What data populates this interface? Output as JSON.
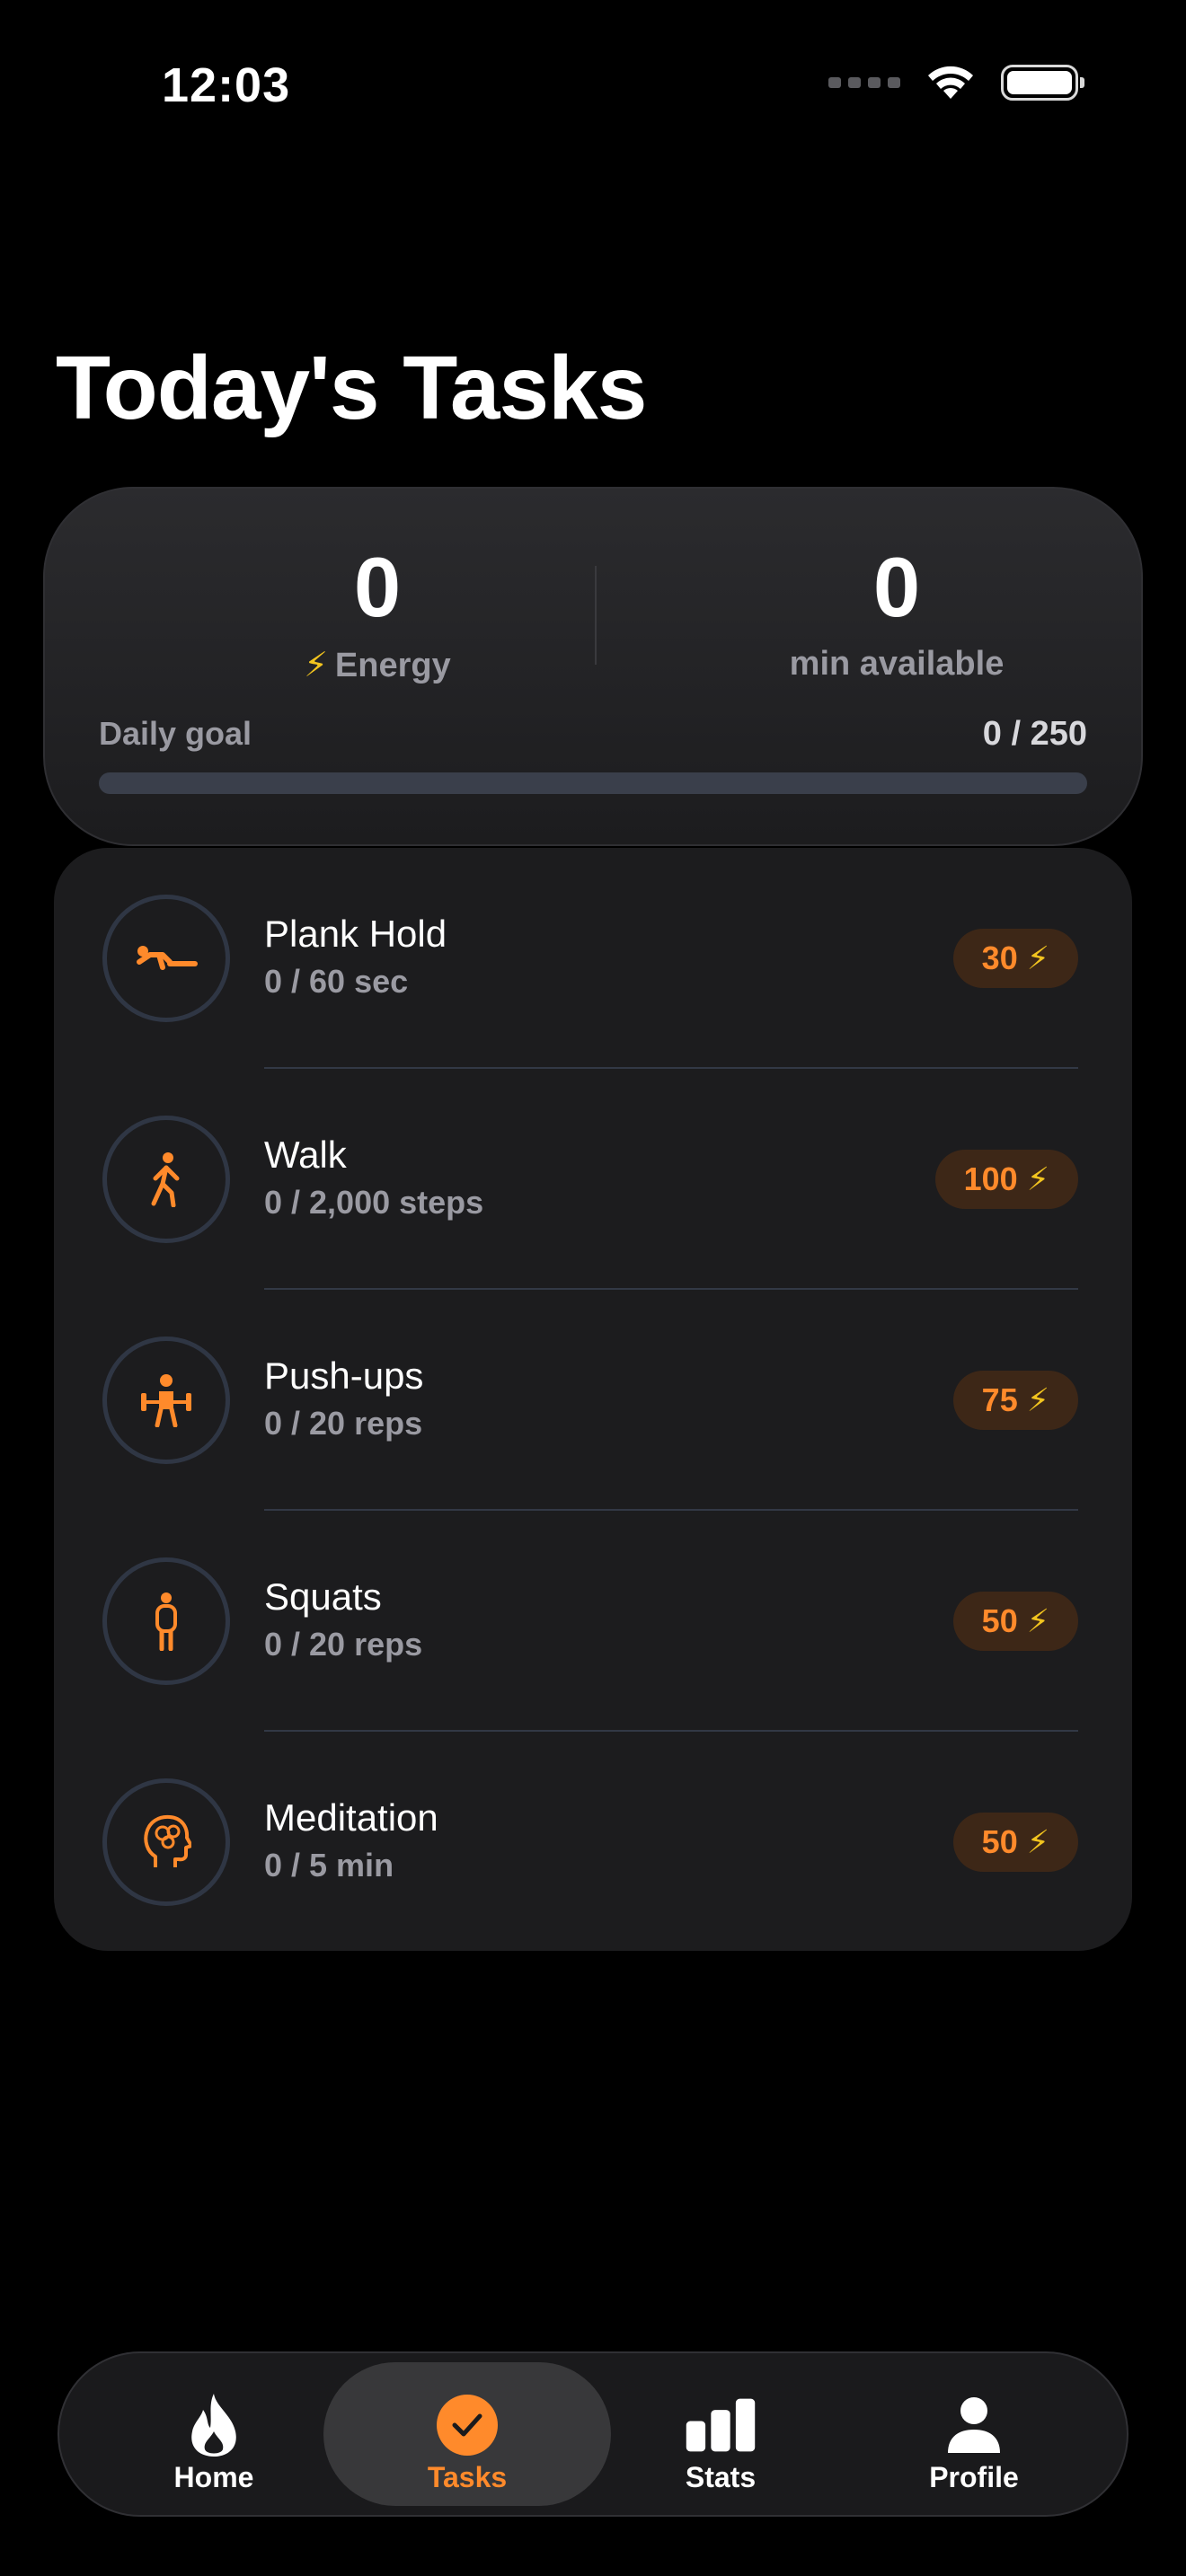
{
  "status_bar": {
    "time": "12:03"
  },
  "page": {
    "title": "Today's Tasks"
  },
  "summary": {
    "energy_value": "0",
    "energy_icon": "⚡",
    "energy_label": "Energy",
    "minutes_value": "0",
    "minutes_label": "min available",
    "goal_label": "Daily goal",
    "goal_value": "0 / 250",
    "goal_progress_fraction": 0
  },
  "tasks": [
    {
      "name": "Plank Hold",
      "progress": "0 / 60 sec",
      "reward": "30",
      "icon": "plank-icon"
    },
    {
      "name": "Walk",
      "progress": "0 / 2,000 steps",
      "reward": "100",
      "icon": "walk-icon"
    },
    {
      "name": "Push-ups",
      "progress": "0 / 20 reps",
      "reward": "75",
      "icon": "weightlifting-icon"
    },
    {
      "name": "Squats",
      "progress": "0 / 20 reps",
      "reward": "50",
      "icon": "person-standing-icon"
    },
    {
      "name": "Meditation",
      "progress": "0 / 5 min",
      "reward": "50",
      "icon": "brain-head-icon"
    }
  ],
  "reward_icon": "⚡",
  "tab_bar": {
    "tabs": [
      {
        "label": "Home",
        "icon": "flame-icon"
      },
      {
        "label": "Tasks",
        "icon": "check-circle-icon",
        "active": true
      },
      {
        "label": "Stats",
        "icon": "bar-chart-icon"
      },
      {
        "label": "Profile",
        "icon": "person-icon"
      }
    ]
  },
  "colors": {
    "accent": "#ff8a2b",
    "bolt": "#f2c41f",
    "background": "#000000",
    "card": "#1c1c1e"
  }
}
